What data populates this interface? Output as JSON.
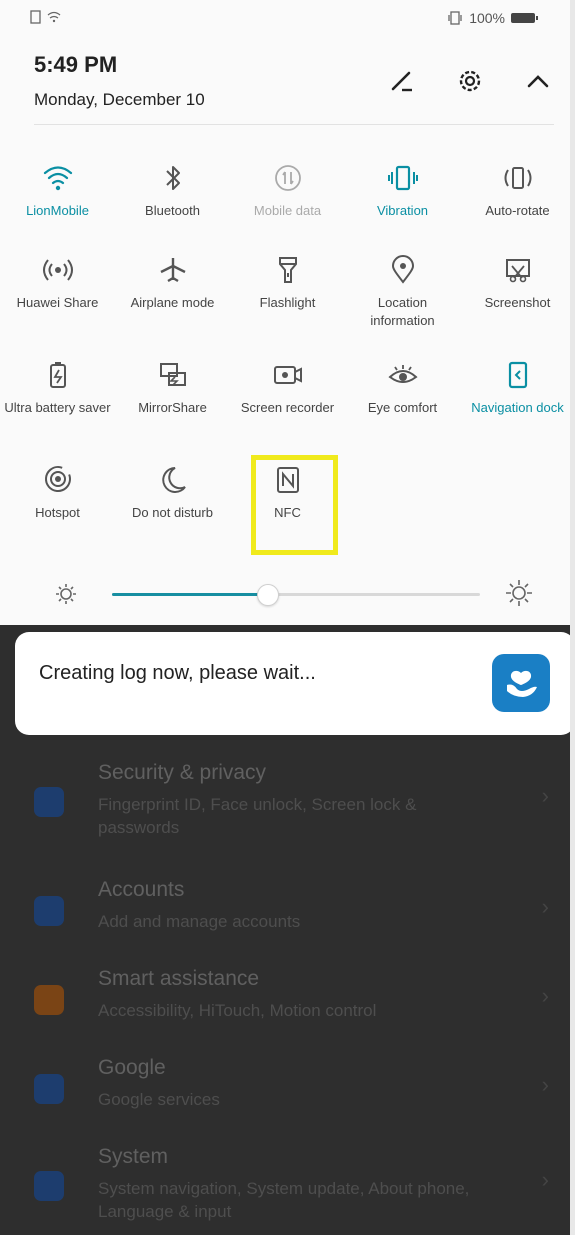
{
  "status_bar": {
    "battery": "100%"
  },
  "header": {
    "time": "5:49 PM",
    "date": "Monday, December 10"
  },
  "tiles": [
    {
      "label": "LionMobile",
      "icon": "wifi-icon",
      "active": true
    },
    {
      "label": "Bluetooth",
      "icon": "bluetooth-icon",
      "active": false
    },
    {
      "label": "Mobile data",
      "icon": "mobile-data-icon",
      "active": false
    },
    {
      "label": "Vibration",
      "icon": "vibration-icon",
      "active": true
    },
    {
      "label": "Auto-rotate",
      "icon": "auto-rotate-icon",
      "active": false
    },
    {
      "label": "Huawei Share",
      "icon": "huawei-share-icon",
      "active": false
    },
    {
      "label": "Airplane mode",
      "icon": "airplane-icon",
      "active": false
    },
    {
      "label": "Flashlight",
      "icon": "flashlight-icon",
      "active": false
    },
    {
      "label": "Location information",
      "icon": "location-icon",
      "active": false
    },
    {
      "label": "Screenshot",
      "icon": "screenshot-icon",
      "active": false
    },
    {
      "label": "Ultra battery saver",
      "icon": "battery-saver-icon",
      "active": false
    },
    {
      "label": "MirrorShare",
      "icon": "mirrorshare-icon",
      "active": false
    },
    {
      "label": "Screen recorder",
      "icon": "screen-recorder-icon",
      "active": false
    },
    {
      "label": "Eye comfort",
      "icon": "eye-comfort-icon",
      "active": false
    },
    {
      "label": "Navigation dock",
      "icon": "navigation-dock-icon",
      "active": true
    },
    {
      "label": "Hotspot",
      "icon": "hotspot-icon",
      "active": false
    },
    {
      "label": "Do not disturb",
      "icon": "moon-icon",
      "active": false
    },
    {
      "label": "NFC",
      "icon": "nfc-icon",
      "active": false
    }
  ],
  "brightness": {
    "level": 0.42
  },
  "toast": {
    "message": "Creating log now, please wait..."
  },
  "settings": [
    {
      "title": "Security & privacy",
      "subtitle": "Fingerprint ID, Face unlock, Screen lock & passwords",
      "icon_color": "#1d3d6e"
    },
    {
      "title": "Accounts",
      "subtitle": "Add and manage accounts",
      "icon_color": "#1d3d6e"
    },
    {
      "title": "Smart assistance",
      "subtitle": "Accessibility, HiTouch, Motion control",
      "icon_color": "#7a4415"
    },
    {
      "title": "Google",
      "subtitle": "Google services",
      "icon_color": "#1d3d6e"
    },
    {
      "title": "System",
      "subtitle": "System navigation, System update, About phone, Language & input",
      "icon_color": "#1d3d6e"
    }
  ],
  "colors": {
    "accent": "#0a8fa3",
    "highlight": "#f0ea1c"
  }
}
